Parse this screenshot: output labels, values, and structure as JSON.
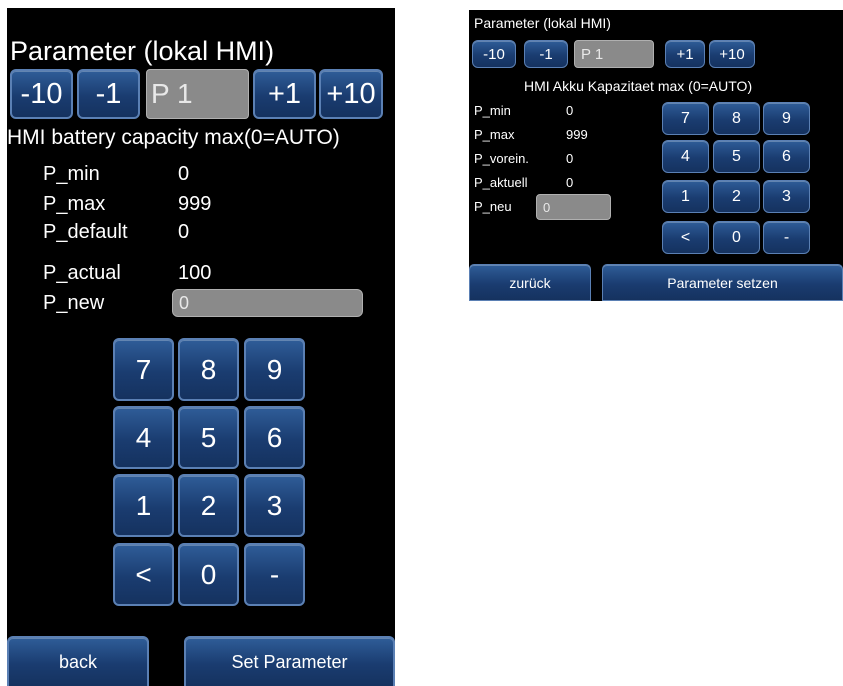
{
  "en": {
    "title": "Parameter (lokal HMI)",
    "nav": {
      "minus10": "-10",
      "minus1": "-1",
      "param": "P 1",
      "plus1": "+1",
      "plus10": "+10"
    },
    "description": "HMI battery capacity max(0=AUTO)",
    "fields": {
      "min_label": "P_min",
      "min_value": "0",
      "max_label": "P_max",
      "max_value": "999",
      "default_label": "P_default",
      "default_value": "0",
      "actual_label": "P_actual",
      "actual_value": "100",
      "new_label": "P_new",
      "new_value": "0"
    },
    "keypad": [
      "7",
      "8",
      "9",
      "4",
      "5",
      "6",
      "1",
      "2",
      "3",
      "<",
      "0",
      "-"
    ],
    "footer": {
      "back": "back",
      "set": "Set Parameter"
    }
  },
  "de": {
    "title": "Parameter (lokal HMI)",
    "nav": {
      "minus10": "-10",
      "minus1": "-1",
      "param": "P 1",
      "plus1": "+1",
      "plus10": "+10"
    },
    "description": "HMI Akku Kapazitaet max (0=AUTO)",
    "fields": {
      "min_label": "P_min",
      "min_value": "0",
      "max_label": "P_max",
      "max_value": "999",
      "default_label": "P_vorein.",
      "default_value": "0",
      "actual_label": "P_aktuell",
      "actual_value": "0",
      "new_label": "P_neu",
      "new_value": "0"
    },
    "keypad": [
      "7",
      "8",
      "9",
      "4",
      "5",
      "6",
      "1",
      "2",
      "3",
      "<",
      "0",
      "-"
    ],
    "footer": {
      "back": "zurück",
      "set": "Parameter setzen"
    }
  }
}
